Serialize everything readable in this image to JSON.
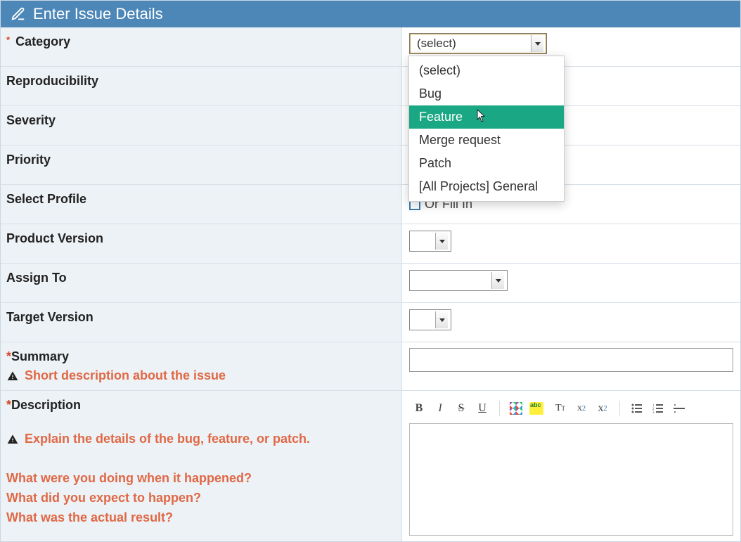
{
  "header": {
    "title": "Enter Issue Details"
  },
  "fields": {
    "category": {
      "label": "Category",
      "required": true,
      "value": "(select)"
    },
    "reproducibility": {
      "label": "Reproducibility"
    },
    "severity": {
      "label": "Severity"
    },
    "priority": {
      "label": "Priority"
    },
    "select_profile": {
      "label": "Select Profile",
      "hint": "Or Fill In"
    },
    "product_version": {
      "label": "Product Version"
    },
    "assign_to": {
      "label": "Assign To"
    },
    "target_version": {
      "label": "Target Version"
    },
    "summary": {
      "label": "Summary",
      "required": true,
      "help": "Short description about the issue"
    },
    "description": {
      "label": "Description",
      "required": true,
      "help_line1": "Explain the details of the bug, feature, or patch.",
      "help_q1": "What were you doing when it happened?",
      "help_q2": "What did you expect to happen?",
      "help_q3": "What was the actual result?"
    }
  },
  "category_dropdown": {
    "options": [
      "(select)",
      "Bug",
      "Feature",
      "Merge request",
      "Patch",
      "[All Projects] General"
    ],
    "highlighted": "Feature"
  },
  "toolbar": {
    "bold": "B",
    "italic": "I",
    "strike": "S",
    "underline": "U",
    "fontsize": "T",
    "sup": "x",
    "sub": "x"
  }
}
